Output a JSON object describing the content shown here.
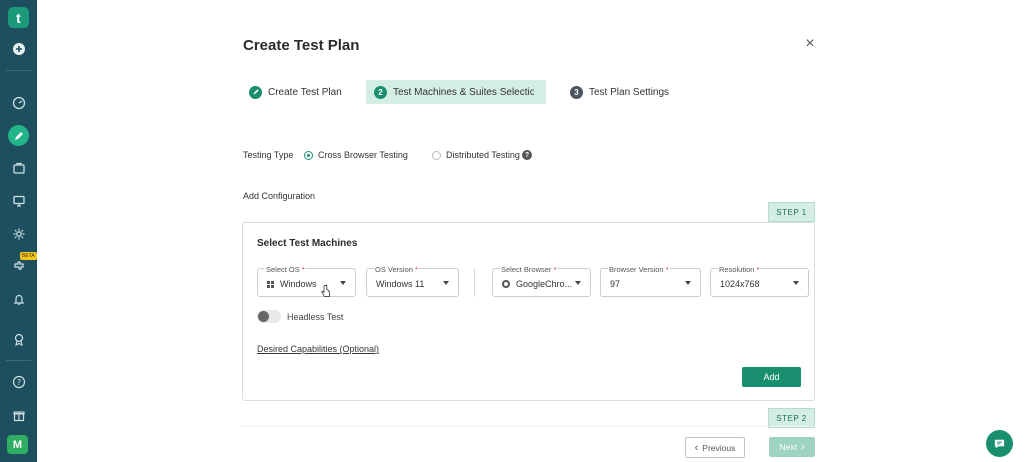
{
  "sidebar": {
    "logo": "t",
    "avatar": "M",
    "beta_badge": "BETA",
    "icons": [
      "add-icon",
      "dashboard-icon",
      "test-plan-icon",
      "briefcase-icon",
      "monitor-icon",
      "settings-icon",
      "integrations-icon",
      "bell-icon",
      "badge-icon",
      "help-icon",
      "gift-icon"
    ]
  },
  "modal": {
    "title": "Create Test Plan",
    "close": "×"
  },
  "stepper": {
    "step1_label": "Create Test Plan",
    "step2_num": "2",
    "step2_label": "Test Machines & Suites Selection",
    "step3_num": "3",
    "step3_label": "Test Plan Settings"
  },
  "testing_type": {
    "label": "Testing Type",
    "option1": "Cross Browser Testing",
    "option2": "Distributed Testing",
    "selected": "Cross Browser Testing",
    "help": "?"
  },
  "config": {
    "heading": "Add Configuration",
    "step1_tag": "STEP 1",
    "step2_tag": "STEP 2",
    "card_title": "Select Test Machines",
    "os_label": "Select OS",
    "os_value": "Windows",
    "os_version_label": "OS Version",
    "os_version_value": "Windows 11",
    "browser_label": "Select Browser",
    "browser_value": "GoogleChro...",
    "browser_version_label": "Browser Version",
    "browser_version_value": "97",
    "resolution_label": "Resolution",
    "resolution_value": "1024x768",
    "required_mark": "*",
    "headless_label": "Headless Test",
    "headless_on": false,
    "desired_capabilities": "Desired Capabilities (Optional)",
    "add_button": "Add"
  },
  "footer": {
    "previous": "Previous",
    "previous_icon": "‹",
    "next": "Next",
    "next_icon": "›"
  },
  "colors": {
    "sidebar": "#1d4f5e",
    "accent": "#1a8f6f",
    "step_highlight": "#d4ede5"
  }
}
